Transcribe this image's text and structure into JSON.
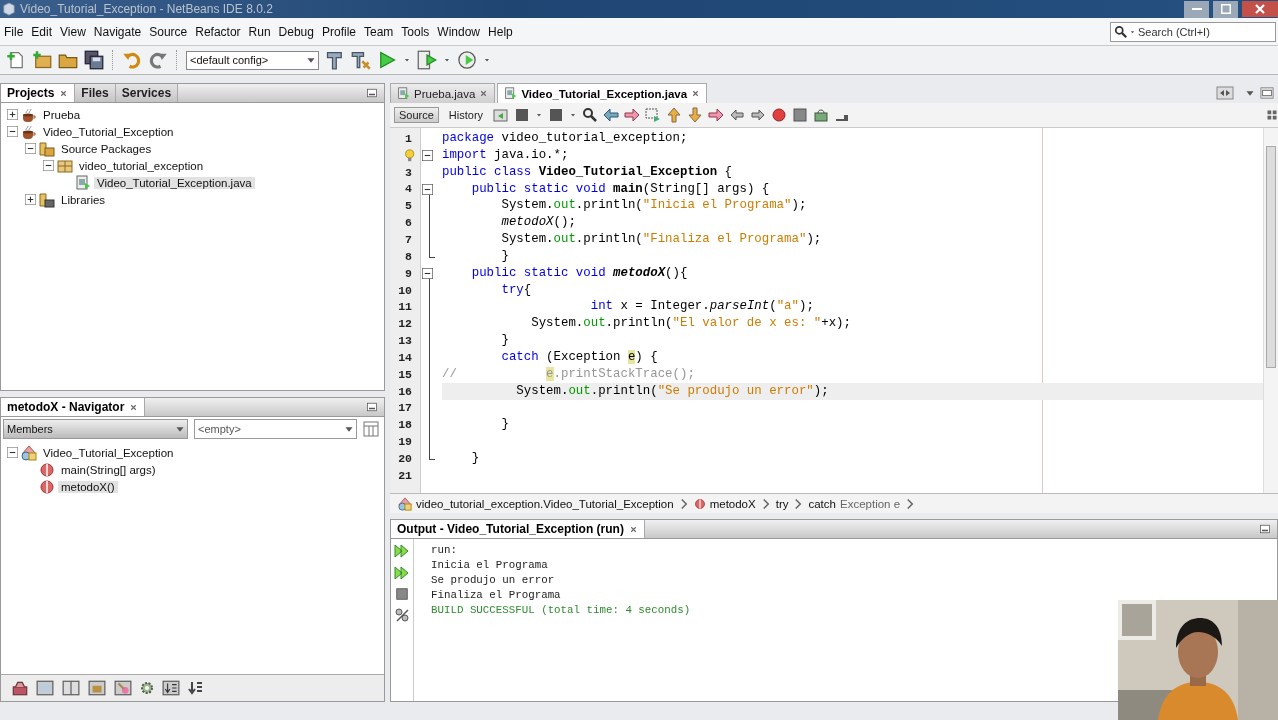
{
  "window": {
    "title": "Video_Tutorial_Exception - NetBeans IDE 8.0.2"
  },
  "menu": [
    "File",
    "Edit",
    "View",
    "Navigate",
    "Source",
    "Refactor",
    "Run",
    "Debug",
    "Profile",
    "Team",
    "Tools",
    "Window",
    "Help"
  ],
  "search": {
    "placeholder": "Search (Ctrl+I)"
  },
  "toolbar": {
    "config": "<default config>"
  },
  "projects_panel": {
    "tabs": [
      {
        "label": "Projects",
        "selected": true
      },
      {
        "label": "Files",
        "selected": false
      },
      {
        "label": "Services",
        "selected": false
      }
    ],
    "tree": [
      {
        "label": "Prueba",
        "kind": "project",
        "expanded": false,
        "selected": false
      },
      {
        "label": "Video_Tutorial_Exception",
        "kind": "project",
        "expanded": true,
        "selected": false,
        "children": [
          {
            "label": "Source Packages",
            "kind": "source-folder",
            "expanded": true,
            "selected": false,
            "children": [
              {
                "label": "video_tutorial_exception",
                "kind": "package",
                "expanded": true,
                "selected": false,
                "children": [
                  {
                    "label": "Video_Tutorial_Exception.java",
                    "kind": "java-file",
                    "selected": true
                  }
                ]
              }
            ]
          },
          {
            "label": "Libraries",
            "kind": "library-folder",
            "expanded": false,
            "selected": false
          }
        ]
      }
    ]
  },
  "navigator": {
    "title": "metodoX - Navigator",
    "filter": "Members",
    "filter_2": "<empty>",
    "tree": [
      {
        "label": "Video_Tutorial_Exception",
        "kind": "class",
        "expanded": true,
        "selected": false,
        "children": [
          {
            "label": "main(String[] args)",
            "kind": "method",
            "selected": false
          },
          {
            "label": "metodoX()",
            "kind": "method",
            "selected": true
          }
        ]
      }
    ]
  },
  "editor": {
    "tabs": [
      {
        "label": "Prueba.java",
        "selected": false
      },
      {
        "label": "Video_Tutorial_Exception.java",
        "selected": true
      }
    ],
    "views": [
      {
        "label": "Source",
        "selected": true
      },
      {
        "label": "History",
        "selected": false
      }
    ],
    "lines": [
      {
        "number": "1",
        "hint": false,
        "kind": "plain",
        "current": false,
        "segments": [
          {
            "kind": "kw",
            "text": "package"
          },
          {
            "kind": "plain",
            "text": " video_tutorial_exception;"
          }
        ]
      },
      {
        "hint": true,
        "kind": "fold-single",
        "current": false,
        "segments": [
          {
            "kind": "kw",
            "text": "import"
          },
          {
            "kind": "plain",
            "text": " java.io.*;"
          }
        ]
      },
      {
        "number": "3",
        "hint": false,
        "kind": "plain",
        "current": false,
        "segments": [
          {
            "kind": "kw",
            "text": "public class "
          },
          {
            "kind": "bold",
            "text": "Video_Tutorial_Exception"
          },
          {
            "kind": "plain",
            "text": " {"
          }
        ]
      },
      {
        "number": "4",
        "hint": false,
        "kind": "fold-start",
        "current": false,
        "segments": [
          {
            "kind": "kw",
            "text": "    public static void "
          },
          {
            "kind": "bold",
            "text": "main"
          },
          {
            "kind": "plain",
            "text": "(String[] args) {"
          }
        ]
      },
      {
        "number": "5",
        "hint": false,
        "kind": "fold-line",
        "current": false,
        "segments": [
          {
            "kind": "plain",
            "text": "        System."
          },
          {
            "kind": "field",
            "text": "out"
          },
          {
            "kind": "plain",
            "text": ".println("
          },
          {
            "kind": "str",
            "text": "\"Inicia el Programa\""
          },
          {
            "kind": "plain",
            "text": ");"
          }
        ]
      },
      {
        "number": "6",
        "hint": false,
        "kind": "fold-line",
        "current": false,
        "segments": [
          {
            "kind": "italic",
            "text": "        metodoX"
          },
          {
            "kind": "plain",
            "text": "();"
          }
        ]
      },
      {
        "number": "7",
        "hint": false,
        "kind": "fold-line",
        "current": false,
        "segments": [
          {
            "kind": "plain",
            "text": "        System."
          },
          {
            "kind": "field",
            "text": "out"
          },
          {
            "kind": "plain",
            "text": ".println("
          },
          {
            "kind": "str",
            "text": "\"Finaliza el Programa\""
          },
          {
            "kind": "plain",
            "text": ");"
          }
        ]
      },
      {
        "number": "8",
        "hint": false,
        "kind": "fold-end",
        "current": false,
        "segments": [
          {
            "kind": "plain",
            "text": "        }"
          }
        ]
      },
      {
        "number": "9",
        "hint": false,
        "kind": "fold-start",
        "current": false,
        "segments": [
          {
            "kind": "kw",
            "text": "    public static void "
          },
          {
            "kind": "bold-italic",
            "text": "metodoX"
          },
          {
            "kind": "plain",
            "text": "(){"
          }
        ]
      },
      {
        "number": "10",
        "hint": false,
        "kind": "fold-line",
        "current": false,
        "segments": [
          {
            "kind": "kw",
            "text": "        try"
          },
          {
            "kind": "plain",
            "text": "{"
          }
        ]
      },
      {
        "number": "11",
        "hint": false,
        "kind": "fold-line",
        "current": false,
        "segments": [
          {
            "kind": "kw",
            "text": "                    int"
          },
          {
            "kind": "plain",
            "text": " x = Integer."
          },
          {
            "kind": "italic",
            "text": "parseInt"
          },
          {
            "kind": "plain",
            "text": "("
          },
          {
            "kind": "str",
            "text": "\"a\""
          },
          {
            "kind": "plain",
            "text": ");"
          }
        ]
      },
      {
        "number": "12",
        "hint": false,
        "kind": "fold-line",
        "current": false,
        "segments": [
          {
            "kind": "plain",
            "text": "            System."
          },
          {
            "kind": "field",
            "text": "out"
          },
          {
            "kind": "plain",
            "text": ".println("
          },
          {
            "kind": "str",
            "text": "\"El valor de x es: \""
          },
          {
            "kind": "plain",
            "text": "+x);"
          }
        ]
      },
      {
        "number": "13",
        "hint": false,
        "kind": "fold-line",
        "current": false,
        "segments": [
          {
            "kind": "plain",
            "text": "        }"
          }
        ]
      },
      {
        "number": "14",
        "hint": false,
        "kind": "fold-line",
        "current": false,
        "segments": [
          {
            "kind": "kw",
            "text": "        catch"
          },
          {
            "kind": "plain",
            "text": " (Exception "
          },
          {
            "kind": "mark",
            "text": "e"
          },
          {
            "kind": "plain",
            "text": ") {"
          }
        ]
      },
      {
        "number": "15",
        "hint": false,
        "kind": "fold-line",
        "current": false,
        "segments": [
          {
            "kind": "comment",
            "text": "//            "
          },
          {
            "kind": "comment-mark",
            "text": "e"
          },
          {
            "kind": "comment",
            "text": ".printStackTrace();"
          }
        ]
      },
      {
        "number": "16",
        "hint": false,
        "kind": "fold-line",
        "current": true,
        "segments": [
          {
            "kind": "plain",
            "text": "          System."
          },
          {
            "kind": "field",
            "text": "out"
          },
          {
            "kind": "plain",
            "text": ".println("
          },
          {
            "kind": "str",
            "text": "\"Se produjo un error\""
          },
          {
            "kind": "plain",
            "text": ");"
          }
        ]
      },
      {
        "number": "17",
        "hint": false,
        "kind": "fold-line",
        "current": false
      },
      {
        "number": "18",
        "hint": false,
        "kind": "fold-line",
        "current": false,
        "segments": [
          {
            "kind": "plain",
            "text": "        }"
          }
        ]
      },
      {
        "number": "19",
        "hint": false,
        "kind": "fold-line",
        "current": false
      },
      {
        "number": "20",
        "hint": false,
        "kind": "fold-end",
        "current": false,
        "segments": [
          {
            "kind": "plain",
            "text": "    }"
          }
        ]
      },
      {
        "number": "21",
        "hint": false,
        "kind": "plain",
        "current": false
      }
    ],
    "breadcrumb": [
      {
        "kind": "class",
        "label": "video_tutorial_exception.Video_Tutorial_Exception"
      },
      {
        "kind": "method",
        "label": "metodoX"
      },
      {
        "kind": "plain",
        "label": "try"
      },
      {
        "kind": "plain",
        "label": "catch",
        "detail": "Exception e"
      }
    ]
  },
  "output": {
    "title": "Output - Video_Tutorial_Exception (run)",
    "lines": [
      {
        "kind": "plain",
        "text": "run:"
      },
      {
        "kind": "plain",
        "text": "Inicia el Programa"
      },
      {
        "kind": "plain",
        "text": "Se produjo un error"
      },
      {
        "kind": "plain",
        "text": "Finaliza el Programa"
      },
      {
        "kind": "success",
        "text": "BUILD SUCCESSFUL (total time: 4 seconds)"
      }
    ]
  }
}
